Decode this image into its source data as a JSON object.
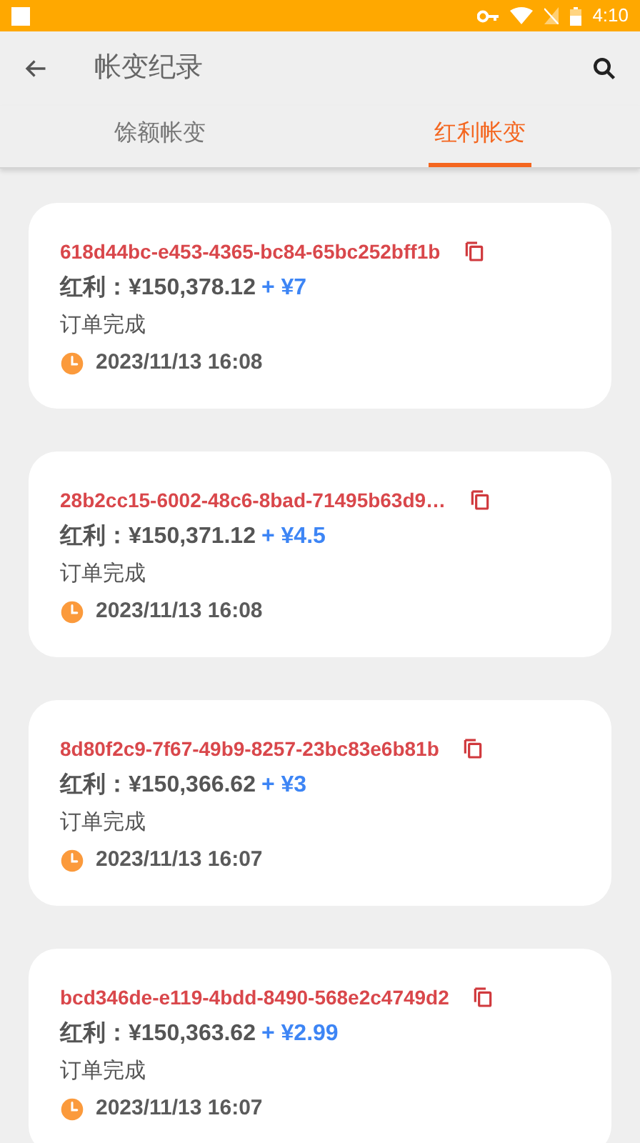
{
  "status_bar": {
    "time": "4:10"
  },
  "header": {
    "title": "帐变纪录"
  },
  "tabs": [
    {
      "label": "馀额帐变",
      "selected": false
    },
    {
      "label": "红利帐变",
      "selected": true
    }
  ],
  "records": [
    {
      "id": "618d44bc-e453-4365-bc84-65bc252bff1b",
      "balance": "红利：¥150,378.12",
      "change": "+ ¥7",
      "status": "订单完成",
      "time": "2023/11/13 16:08"
    },
    {
      "id": "28b2cc15-6002-48c6-8bad-71495b63d9…",
      "balance": "红利：¥150,371.12",
      "change": "+ ¥4.5",
      "status": "订单完成",
      "time": "2023/11/13 16:08"
    },
    {
      "id": "8d80f2c9-7f67-49b9-8257-23bc83e6b81b",
      "balance": "红利：¥150,366.62",
      "change": "+ ¥3",
      "status": "订单完成",
      "time": "2023/11/13 16:07"
    },
    {
      "id": "bcd346de-e119-4bdd-8490-568e2c4749d2",
      "balance": "红利：¥150,363.62",
      "change": "+ ¥2.99",
      "status": "订单完成",
      "time": "2023/11/13 16:07"
    }
  ]
}
